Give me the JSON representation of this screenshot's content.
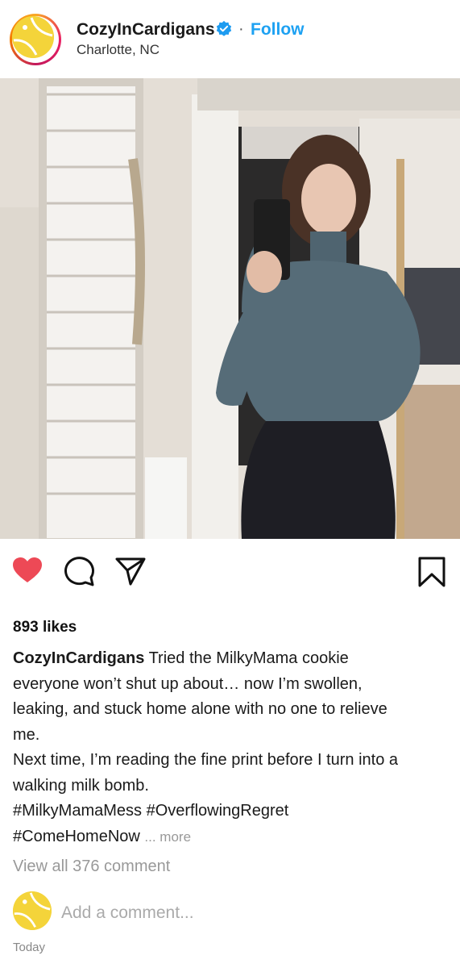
{
  "header": {
    "username": "CozyInCardigans",
    "separator": "·",
    "follow_label": "Follow",
    "location": "Charlotte, NC"
  },
  "icons": {
    "verified": "verified-badge-icon",
    "like": "heart-icon",
    "comment": "comment-bubble-icon",
    "share": "paper-plane-icon",
    "save": "bookmark-icon"
  },
  "colors": {
    "follow": "#1da1f2",
    "liked_heart": "#ed4956",
    "verified": "#1d9bf0",
    "avatar": "#f4d43a"
  },
  "post": {
    "likes": "893 likes",
    "caption_user": "CozyInCardigans",
    "caption_lines": [
      "Tried the MilkyMama cookie",
      "everyone won’t shut up about… now I’m swollen,",
      "leaking, and stuck home alone with no one to relieve",
      "me.",
      "Next time, I’m reading the fine print before I turn into a",
      "walking milk bomb.",
      "#MilkyMamaMess #OverflowingRegret",
      "#ComeHomeNow"
    ],
    "more_label": "... more",
    "view_all": "View all 376 comment",
    "add_comment_placeholder": "Add a comment...",
    "timestamp": "Today"
  }
}
